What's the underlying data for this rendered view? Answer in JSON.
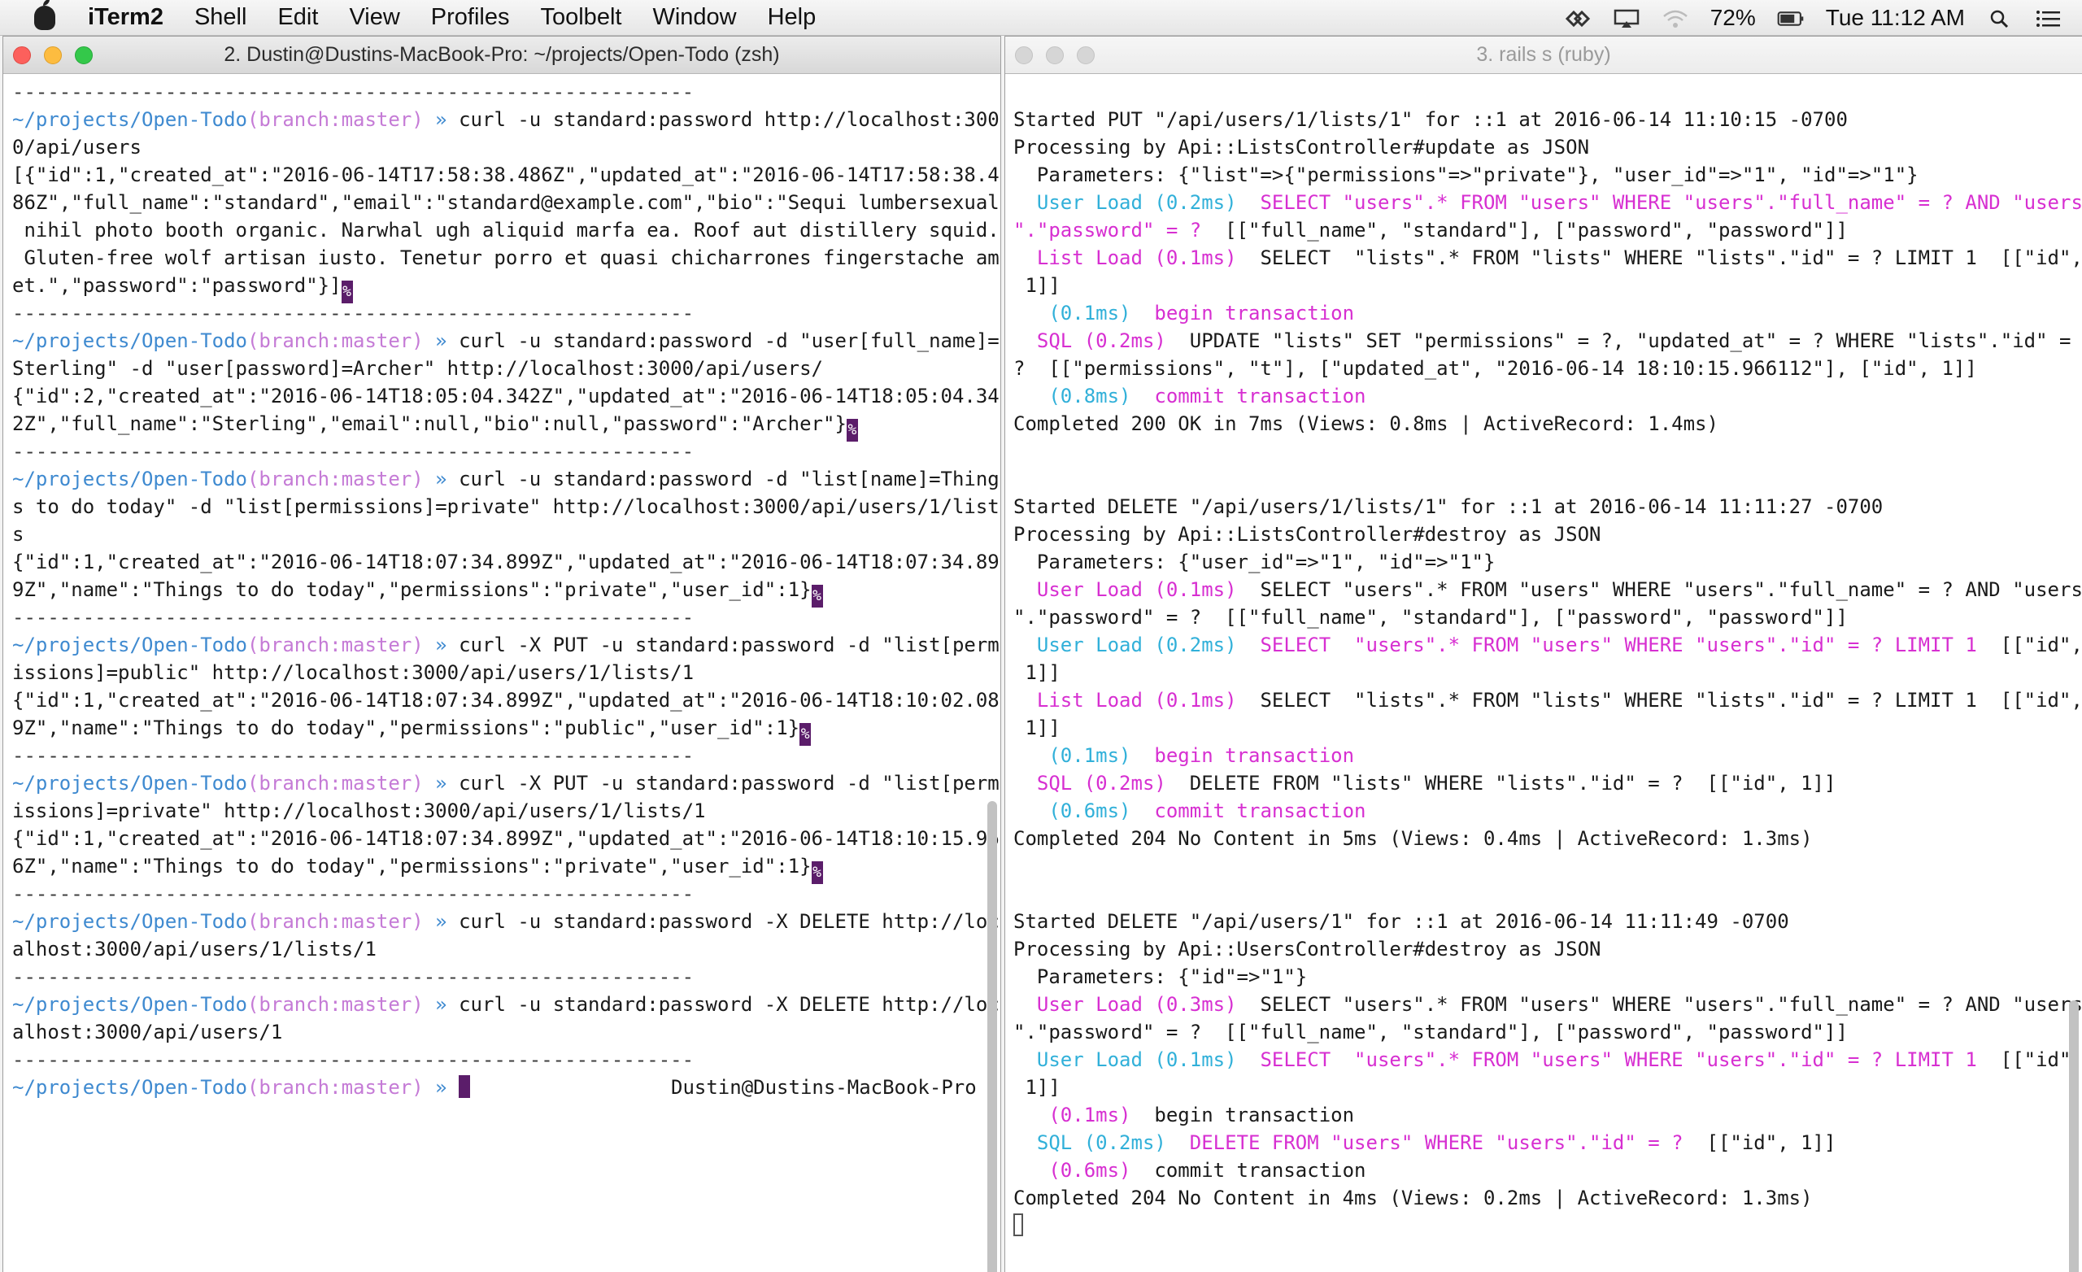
{
  "menubar": {
    "app_name": "iTerm2",
    "items": [
      "Shell",
      "Edit",
      "View",
      "Profiles",
      "Toolbelt",
      "Window",
      "Help"
    ],
    "battery": "72%",
    "clock": "Tue 11:12 AM"
  },
  "left_window": {
    "title": "2. Dustin@Dustins-MacBook-Pro: ~/projects/Open-Todo (zsh)",
    "separator": "----------------------------------------------------------",
    "prompt_path": "~/projects/Open-Todo",
    "prompt_branch": "(branch:master)",
    "prompt_arrow": " » ",
    "right_prompt": "Dustin@Dustins-MacBook-Pro",
    "blocks": [
      {
        "cmd": [
          "curl -u standard:password http://localhost:300",
          "0/api/users"
        ],
        "out": [
          "[{\"id\":1,\"created_at\":\"2016-06-14T17:58:38.486Z\",\"updated_at\":\"2016-06-14T17:58:38.4",
          "86Z\",\"full_name\":\"standard\",\"email\":\"standard@example.com\",\"bio\":\"Sequi lumbersexual",
          " nihil photo booth organic. Narwhal ugh aliquid marfa ea. Roof aut distillery squid.",
          " Gluten-free wolf artisan iusto. Tenetur porro et quasi chicharrones fingerstache am",
          "et.\",\"password\":\"password\"}]"
        ],
        "mark": "%"
      },
      {
        "cmd": [
          "curl -u standard:password -d \"user[full_name]=",
          "Sterling\" -d \"user[password]=Archer\" http://localhost:3000/api/users/"
        ],
        "out": [
          "{\"id\":2,\"created_at\":\"2016-06-14T18:05:04.342Z\",\"updated_at\":\"2016-06-14T18:05:04.34",
          "2Z\",\"full_name\":\"Sterling\",\"email\":null,\"bio\":null,\"password\":\"Archer\"}"
        ],
        "mark": "%"
      },
      {
        "cmd": [
          "curl -u standard:password -d \"list[name]=Thing",
          "s to do today\" -d \"list[permissions]=private\" http://localhost:3000/api/users/1/list",
          "s"
        ],
        "out": [
          "{\"id\":1,\"created_at\":\"2016-06-14T18:07:34.899Z\",\"updated_at\":\"2016-06-14T18:07:34.89",
          "9Z\",\"name\":\"Things to do today\",\"permissions\":\"private\",\"user_id\":1}"
        ],
        "mark": "%"
      },
      {
        "cmd": [
          "curl -X PUT -u standard:password -d \"list[perm",
          "issions]=public\" http://localhost:3000/api/users/1/lists/1"
        ],
        "out": [
          "{\"id\":1,\"created_at\":\"2016-06-14T18:07:34.899Z\",\"updated_at\":\"2016-06-14T18:10:02.08",
          "9Z\",\"name\":\"Things to do today\",\"permissions\":\"public\",\"user_id\":1}"
        ],
        "mark": "%"
      },
      {
        "cmd": [
          "curl -X PUT -u standard:password -d \"list[perm",
          "issions]=private\" http://localhost:3000/api/users/1/lists/1"
        ],
        "out": [
          "{\"id\":1,\"created_at\":\"2016-06-14T18:07:34.899Z\",\"updated_at\":\"2016-06-14T18:10:15.96",
          "6Z\",\"name\":\"Things to do today\",\"permissions\":\"private\",\"user_id\":1}"
        ],
        "mark": "%"
      },
      {
        "cmd": [
          "curl -u standard:password -X DELETE http://loc",
          "alhost:3000/api/users/1/lists/1"
        ],
        "out": [],
        "mark": ""
      },
      {
        "cmd": [
          "curl -u standard:password -X DELETE http://loc",
          "alhost:3000/api/users/1"
        ],
        "out": [],
        "mark": ""
      }
    ]
  },
  "right_window": {
    "title": "3. rails s (ruby)",
    "lines": [
      {
        "segs": [
          {
            "t": "",
            "c": ""
          }
        ]
      },
      {
        "segs": [
          {
            "t": "Started PUT \"/api/users/1/lists/1\" for ::1 at 2016-06-14 11:10:15 -0700",
            "c": ""
          }
        ]
      },
      {
        "segs": [
          {
            "t": "Processing by Api::ListsController#update as JSON",
            "c": ""
          }
        ]
      },
      {
        "segs": [
          {
            "t": "  Parameters: {\"list\"=>{\"permissions\"=>\"private\"}, \"user_id\"=>\"1\", \"id\"=>\"1\"}",
            "c": ""
          }
        ]
      },
      {
        "segs": [
          {
            "t": "  User Load (0.2ms)",
            "c": "cyan"
          },
          {
            "t": "  SELECT \"users\".* FROM \"users\" WHERE \"users\".\"full_name\" = ? AND \"users",
            "c": "magenta"
          }
        ]
      },
      {
        "segs": [
          {
            "t": "\".\"password\" = ?",
            "c": "magenta"
          },
          {
            "t": "  [[\"full_name\", \"standard\"], [\"password\", \"password\"]]",
            "c": ""
          }
        ]
      },
      {
        "segs": [
          {
            "t": "  List Load (0.1ms)",
            "c": "magenta"
          },
          {
            "t": "  SELECT  \"lists\".* FROM \"lists\" WHERE \"lists\".\"id\" = ? LIMIT 1  [[\"id\",",
            "c": ""
          }
        ]
      },
      {
        "segs": [
          {
            "t": " 1]]",
            "c": ""
          }
        ]
      },
      {
        "segs": [
          {
            "t": "   (0.1ms)",
            "c": "cyan"
          },
          {
            "t": "  begin transaction",
            "c": "magenta"
          }
        ]
      },
      {
        "segs": [
          {
            "t": "  SQL (0.2ms)",
            "c": "magenta"
          },
          {
            "t": "  UPDATE \"lists\" SET \"permissions\" = ?, \"updated_at\" = ? WHERE \"lists\".\"id\" =",
            "c": ""
          }
        ]
      },
      {
        "segs": [
          {
            "t": "?  [[\"permissions\", \"t\"], [\"updated_at\", \"2016-06-14 18:10:15.966112\"], [\"id\", 1]]",
            "c": ""
          }
        ]
      },
      {
        "segs": [
          {
            "t": "   (0.8ms)",
            "c": "cyan"
          },
          {
            "t": "  commit transaction",
            "c": "magenta"
          }
        ]
      },
      {
        "segs": [
          {
            "t": "Completed 200 OK in 7ms (Views: 0.8ms | ActiveRecord: 1.4ms)",
            "c": ""
          }
        ]
      },
      {
        "segs": [
          {
            "t": "",
            "c": ""
          }
        ]
      },
      {
        "segs": [
          {
            "t": "",
            "c": ""
          }
        ]
      },
      {
        "segs": [
          {
            "t": "Started DELETE \"/api/users/1/lists/1\" for ::1 at 2016-06-14 11:11:27 -0700",
            "c": ""
          }
        ]
      },
      {
        "segs": [
          {
            "t": "Processing by Api::ListsController#destroy as JSON",
            "c": ""
          }
        ]
      },
      {
        "segs": [
          {
            "t": "  Parameters: {\"user_id\"=>\"1\", \"id\"=>\"1\"}",
            "c": ""
          }
        ]
      },
      {
        "segs": [
          {
            "t": "  User Load (0.1ms)",
            "c": "magenta"
          },
          {
            "t": "  SELECT \"users\".* FROM \"users\" WHERE \"users\".\"full_name\" = ? AND \"users",
            "c": ""
          }
        ]
      },
      {
        "segs": [
          {
            "t": "\".\"password\" = ?  [[\"full_name\", \"standard\"], [\"password\", \"password\"]]",
            "c": ""
          }
        ]
      },
      {
        "segs": [
          {
            "t": "  User Load (0.2ms)",
            "c": "cyan"
          },
          {
            "t": "  SELECT  \"users\".* FROM \"users\" WHERE \"users\".\"id\" = ? LIMIT 1",
            "c": "magenta"
          },
          {
            "t": "  [[\"id\",",
            "c": ""
          }
        ]
      },
      {
        "segs": [
          {
            "t": " 1]]",
            "c": ""
          }
        ]
      },
      {
        "segs": [
          {
            "t": "  List Load (0.1ms)",
            "c": "magenta"
          },
          {
            "t": "  SELECT  \"lists\".* FROM \"lists\" WHERE \"lists\".\"id\" = ? LIMIT 1  [[\"id\",",
            "c": ""
          }
        ]
      },
      {
        "segs": [
          {
            "t": " 1]]",
            "c": ""
          }
        ]
      },
      {
        "segs": [
          {
            "t": "   (0.1ms)",
            "c": "cyan"
          },
          {
            "t": "  begin transaction",
            "c": "magenta"
          }
        ]
      },
      {
        "segs": [
          {
            "t": "  SQL (0.2ms)",
            "c": "magenta"
          },
          {
            "t": "  DELETE FROM \"lists\" WHERE \"lists\".\"id\" = ?  [[\"id\", 1]]",
            "c": ""
          }
        ]
      },
      {
        "segs": [
          {
            "t": "   (0.6ms)",
            "c": "cyan"
          },
          {
            "t": "  commit transaction",
            "c": "magenta"
          }
        ]
      },
      {
        "segs": [
          {
            "t": "Completed 204 No Content in 5ms (Views: 0.4ms | ActiveRecord: 1.3ms)",
            "c": ""
          }
        ]
      },
      {
        "segs": [
          {
            "t": "",
            "c": ""
          }
        ]
      },
      {
        "segs": [
          {
            "t": "",
            "c": ""
          }
        ]
      },
      {
        "segs": [
          {
            "t": "Started DELETE \"/api/users/1\" for ::1 at 2016-06-14 11:11:49 -0700",
            "c": ""
          }
        ]
      },
      {
        "segs": [
          {
            "t": "Processing by Api::UsersController#destroy as JSON",
            "c": ""
          }
        ]
      },
      {
        "segs": [
          {
            "t": "  Parameters: {\"id\"=>\"1\"}",
            "c": ""
          }
        ]
      },
      {
        "segs": [
          {
            "t": "  User Load (0.3ms)",
            "c": "magenta"
          },
          {
            "t": "  SELECT \"users\".* FROM \"users\" WHERE \"users\".\"full_name\" = ? AND \"users",
            "c": ""
          }
        ]
      },
      {
        "segs": [
          {
            "t": "\".\"password\" = ?  [[\"full_name\", \"standard\"], [\"password\", \"password\"]]",
            "c": ""
          }
        ]
      },
      {
        "segs": [
          {
            "t": "  User Load (0.1ms)",
            "c": "cyan"
          },
          {
            "t": "  SELECT  \"users\".* FROM \"users\" WHERE \"users\".\"id\" = ? LIMIT 1",
            "c": "magenta"
          },
          {
            "t": "  [[\"id\",",
            "c": ""
          }
        ]
      },
      {
        "segs": [
          {
            "t": " 1]]",
            "c": ""
          }
        ]
      },
      {
        "segs": [
          {
            "t": "   (0.1ms)",
            "c": "magenta"
          },
          {
            "t": "  begin transaction",
            "c": ""
          }
        ]
      },
      {
        "segs": [
          {
            "t": "  SQL (0.2ms)",
            "c": "cyan"
          },
          {
            "t": "  DELETE FROM \"users\" WHERE \"users\".\"id\" = ?",
            "c": "magenta"
          },
          {
            "t": "  [[\"id\", 1]]",
            "c": ""
          }
        ]
      },
      {
        "segs": [
          {
            "t": "   (0.6ms)",
            "c": "magenta"
          },
          {
            "t": "  commit transaction",
            "c": ""
          }
        ]
      },
      {
        "segs": [
          {
            "t": "Completed 204 No Content in 4ms (Views: 0.2ms | ActiveRecord: 1.3ms)",
            "c": ""
          }
        ]
      }
    ]
  },
  "colors": {
    "path": "#3f8ad0",
    "branch": "#c57bd6",
    "cyan": "#31b0d9",
    "magenta": "#d72fd1",
    "cursor": "#5b1d6a"
  }
}
